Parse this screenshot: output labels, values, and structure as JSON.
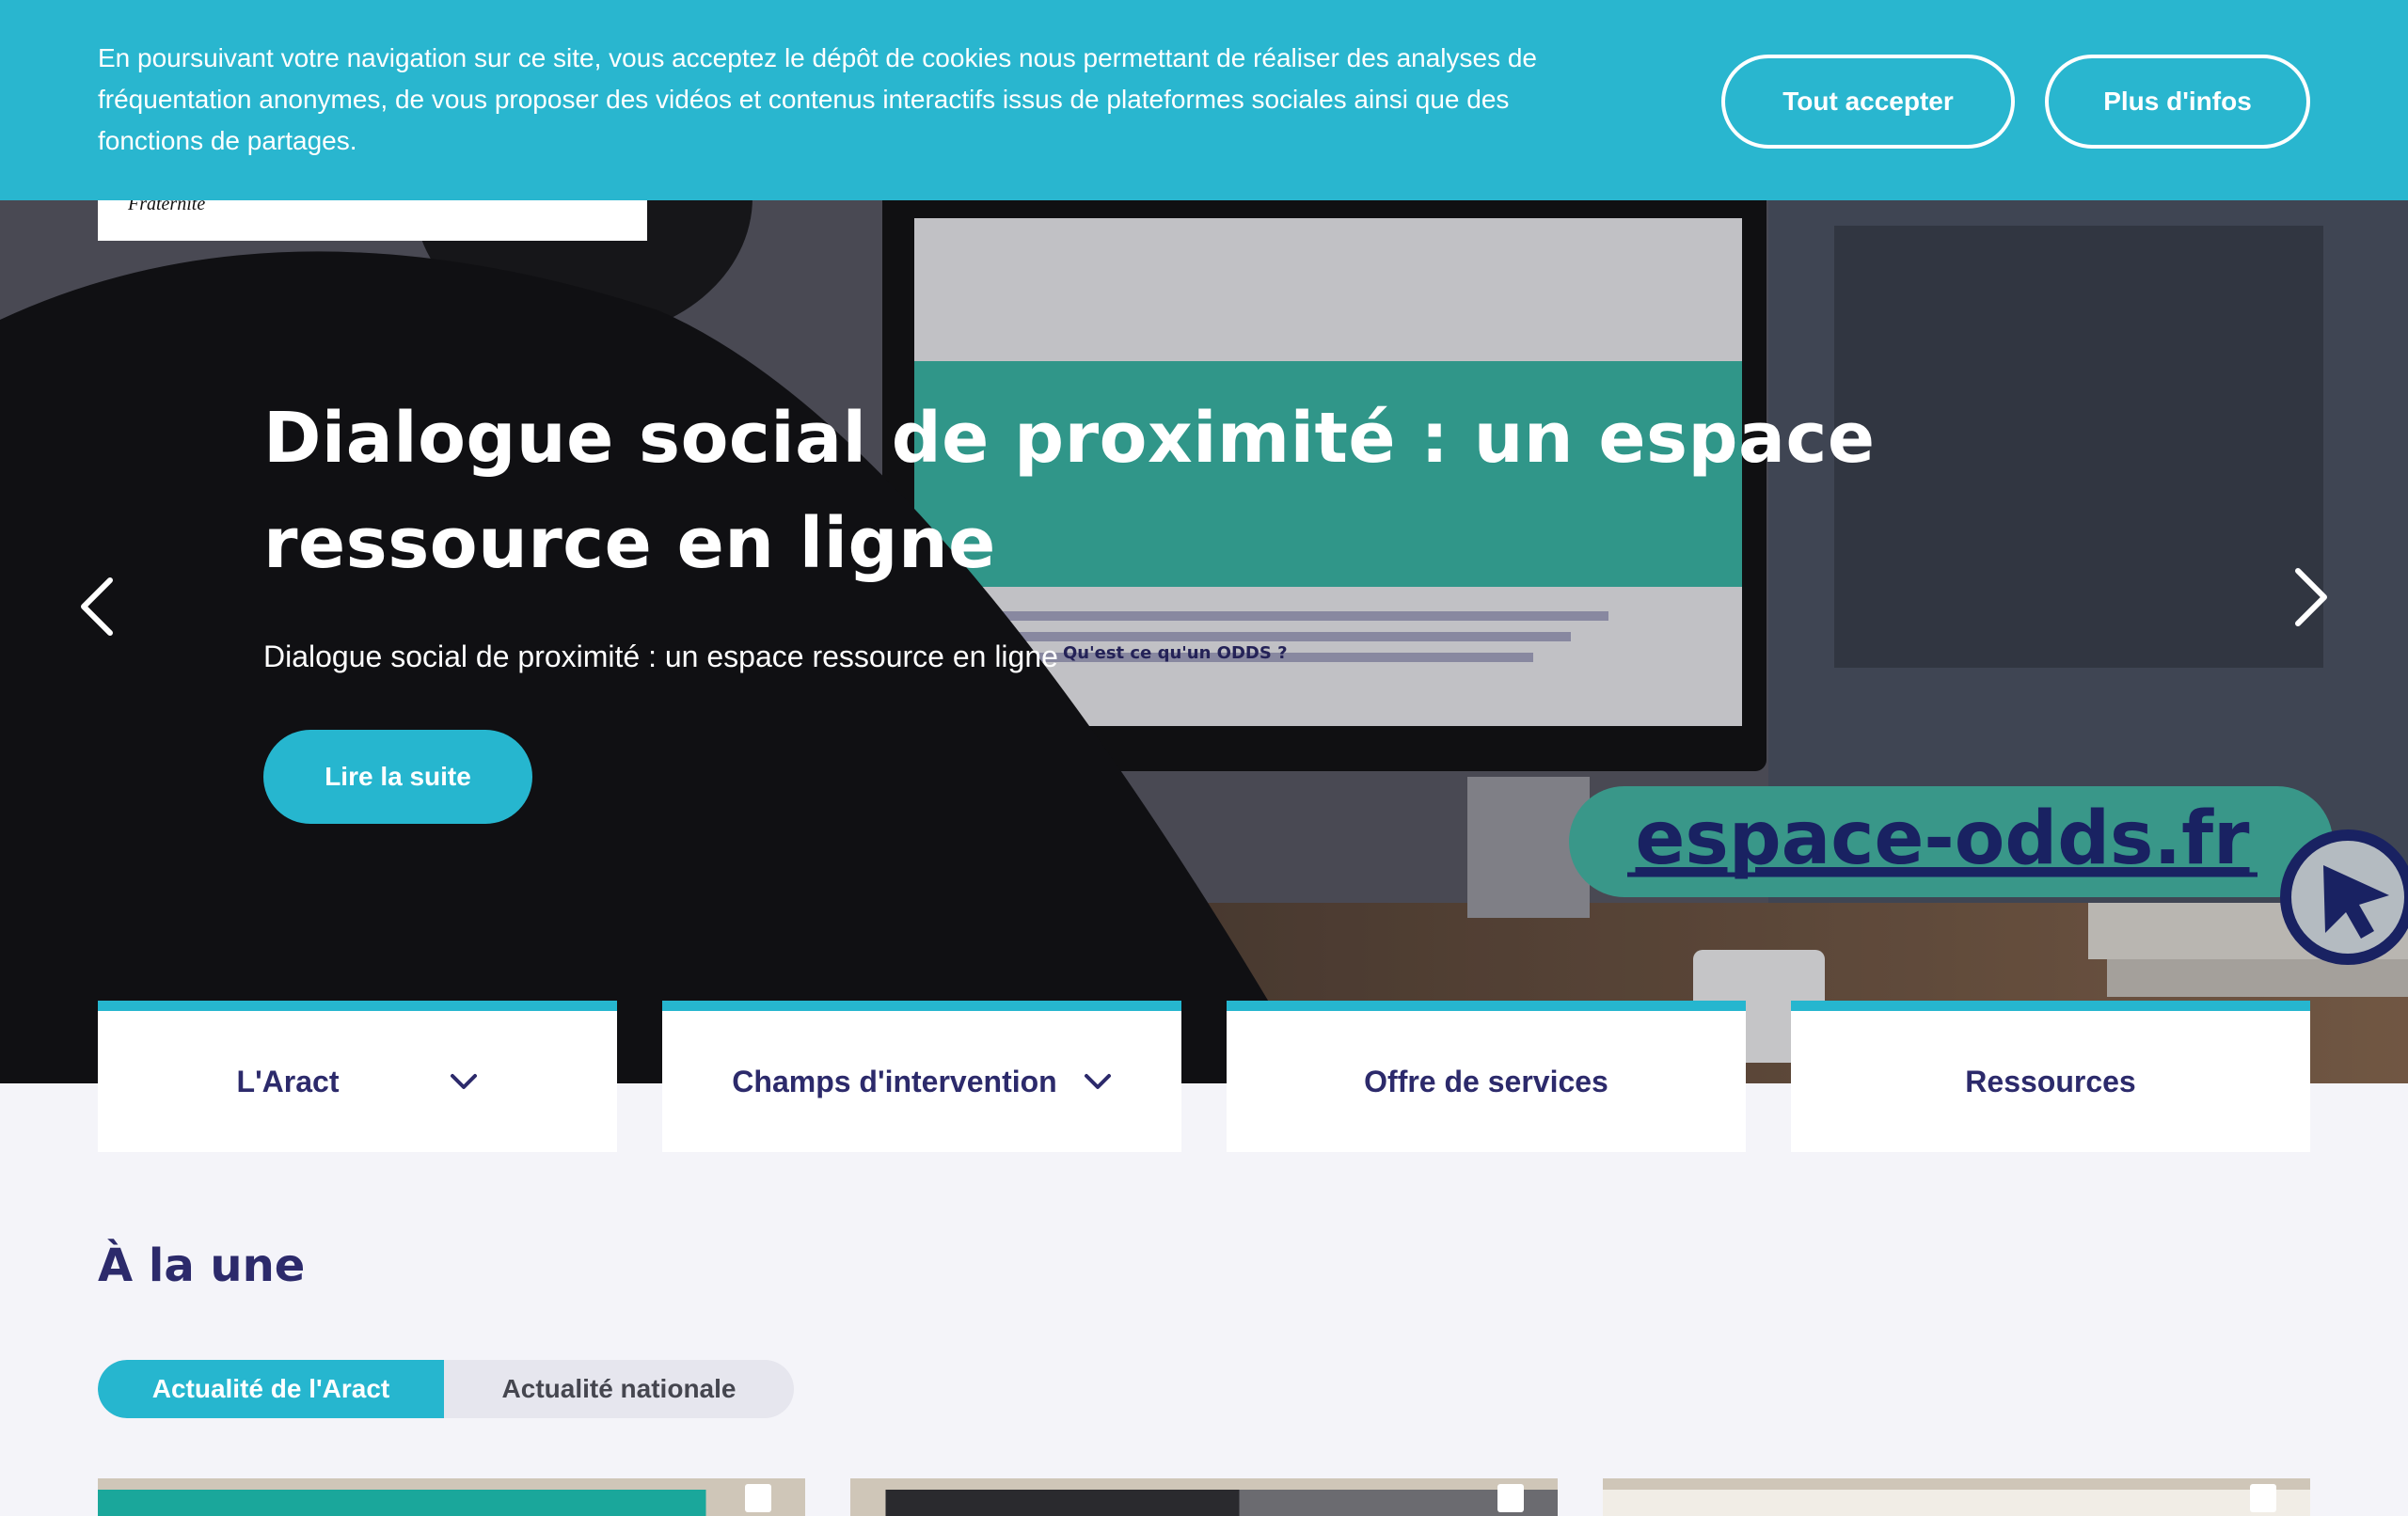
{
  "cookie_banner": {
    "text": "En poursuivant votre navigation sur ce site, vous acceptez le dépôt de cookies nous permettant de réaliser des analyses de fréquentation anonymes, de vous proposer des vidéos et contenus interactifs issus de plateformes sociales ainsi que des fonctions de partages.",
    "accept_label": "Tout accepter",
    "info_label": "Plus d'infos"
  },
  "logo": {
    "motto": "Fraternité"
  },
  "hero": {
    "title": "Dialogue social de proximité : un espace ressource en ligne",
    "subtitle": "Dialogue social de proximité : un espace ressource en ligne",
    "cta_label": "Lire la suite",
    "screen_text": "Qu'est ce qu'un ODDS ?",
    "banner_text": "espace-odds.fr",
    "prev_icon": "chevron-left-icon",
    "next_icon": "chevron-right-icon"
  },
  "nav": {
    "items": [
      {
        "label": "L'Aract",
        "has_dropdown": true
      },
      {
        "label": "Champs d'intervention",
        "has_dropdown": true
      },
      {
        "label": "Offre de services",
        "has_dropdown": false
      },
      {
        "label": "Ressources",
        "has_dropdown": false
      }
    ]
  },
  "section": {
    "title": "À la une",
    "tabs": [
      {
        "label": "Actualité de l'Aract",
        "active": true
      },
      {
        "label": "Actualité nationale",
        "active": false
      }
    ]
  },
  "colors": {
    "accent": "#26b6cf",
    "navy": "#2c2a6b",
    "page_bg": "#f4f4f9"
  }
}
